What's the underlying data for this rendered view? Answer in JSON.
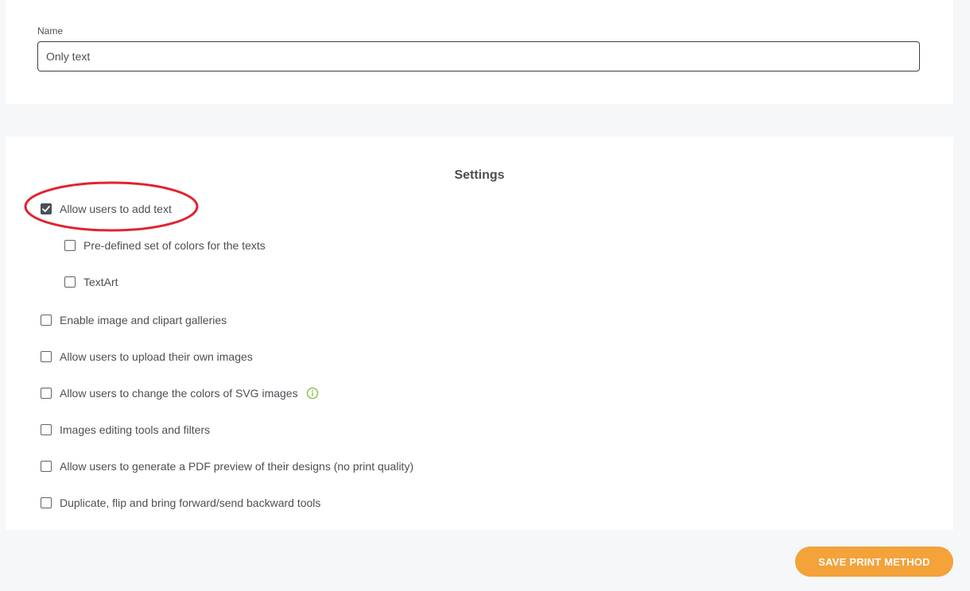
{
  "name_field": {
    "label": "Name",
    "value": "Only text"
  },
  "settings": {
    "title": "Settings",
    "options": [
      {
        "label": "Allow users to add text",
        "checked": true
      },
      {
        "label": "Pre-defined set of colors for the texts",
        "checked": false
      },
      {
        "label": "TextArt",
        "checked": false
      },
      {
        "label": "Enable image and clipart galleries",
        "checked": false
      },
      {
        "label": "Allow users to upload their own images",
        "checked": false
      },
      {
        "label": "Allow users to change the colors of SVG images",
        "checked": false,
        "icon": "info-icon"
      },
      {
        "label": "Images editing tools and filters",
        "checked": false
      },
      {
        "label": "Allow users to generate a PDF preview of their designs (no print quality)",
        "checked": false
      },
      {
        "label": "Duplicate, flip and bring forward/send backward tools",
        "checked": false
      }
    ]
  },
  "save_button": {
    "label": "SAVE PRINT METHOD"
  },
  "colors": {
    "accent_button": "#f4a23a",
    "info_icon": "#8bc34a",
    "annotation_circle": "#e0242f",
    "checkbox_checked": "#495057"
  }
}
